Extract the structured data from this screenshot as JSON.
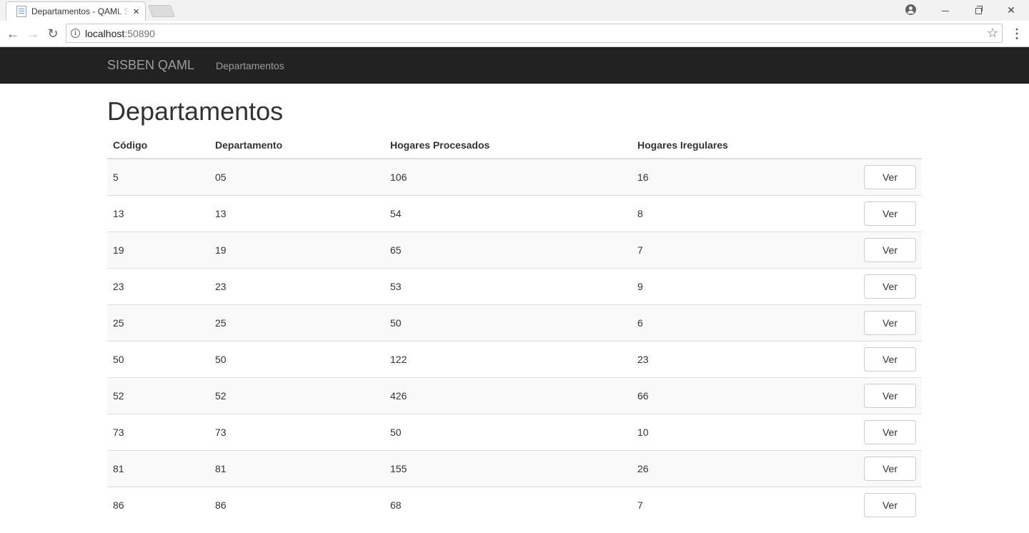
{
  "browser": {
    "tab_title": "Departamentos - QAML Sisben",
    "tab_close": "×",
    "url_host": "localhost",
    "url_port": ":50890"
  },
  "navbar": {
    "brand": "SISBEN QAML",
    "links": [
      {
        "label": "Departamentos"
      }
    ]
  },
  "main": {
    "title": "Departamentos",
    "table": {
      "headers": [
        "Código",
        "Departamento",
        "Hogares Procesados",
        "Hogares Iregulares",
        ""
      ],
      "rows": [
        {
          "codigo": "5",
          "departamento": "05",
          "procesados": "106",
          "irregulares": "16",
          "action": "Ver"
        },
        {
          "codigo": "13",
          "departamento": "13",
          "procesados": "54",
          "irregulares": "8",
          "action": "Ver"
        },
        {
          "codigo": "19",
          "departamento": "19",
          "procesados": "65",
          "irregulares": "7",
          "action": "Ver"
        },
        {
          "codigo": "23",
          "departamento": "23",
          "procesados": "53",
          "irregulares": "9",
          "action": "Ver"
        },
        {
          "codigo": "25",
          "departamento": "25",
          "procesados": "50",
          "irregulares": "6",
          "action": "Ver"
        },
        {
          "codigo": "50",
          "departamento": "50",
          "procesados": "122",
          "irregulares": "23",
          "action": "Ver"
        },
        {
          "codigo": "52",
          "departamento": "52",
          "procesados": "426",
          "irregulares": "66",
          "action": "Ver"
        },
        {
          "codigo": "73",
          "departamento": "73",
          "procesados": "50",
          "irregulares": "10",
          "action": "Ver"
        },
        {
          "codigo": "81",
          "departamento": "81",
          "procesados": "155",
          "irregulares": "26",
          "action": "Ver"
        },
        {
          "codigo": "86",
          "departamento": "86",
          "procesados": "68",
          "irregulares": "7",
          "action": "Ver"
        }
      ]
    }
  },
  "colors": {
    "navbar_bg": "#222222",
    "navbar_text": "#9d9d9d",
    "stripe": "#f9f9f9",
    "border": "#dddddd"
  },
  "icons": [
    "page-favicon-icon",
    "close-tab-icon",
    "profile-icon",
    "back-arrow-icon",
    "forward-arrow-icon",
    "reload-icon",
    "info-icon",
    "star-icon",
    "menu-icon"
  ]
}
